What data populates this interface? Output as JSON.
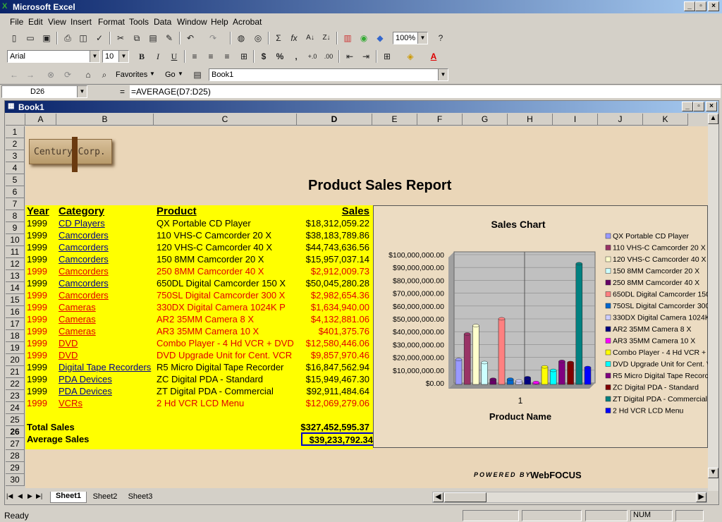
{
  "app": {
    "title": "Microsoft Excel"
  },
  "menu": [
    "File",
    "Edit",
    "View",
    "Insert",
    "Format",
    "Tools",
    "Data",
    "Window",
    "Help",
    "Acrobat"
  ],
  "toolbar": {
    "font": "Arial",
    "size": "10",
    "zoom": "100%",
    "favorites": "Favorites",
    "go": "Go",
    "address": "Book1"
  },
  "formula": {
    "cellref": "D26",
    "eq": "=",
    "content": "=AVERAGE(D7:D25)"
  },
  "workbook": {
    "title": "Book1"
  },
  "columns": [
    "A",
    "B",
    "C",
    "D",
    "E",
    "F",
    "G",
    "H",
    "I",
    "J",
    "K"
  ],
  "rows": [
    "1",
    "2",
    "3",
    "4",
    "5",
    "6",
    "7",
    "8",
    "9",
    "10",
    "11",
    "12",
    "13",
    "14",
    "15",
    "16",
    "17",
    "18",
    "19",
    "20",
    "21",
    "22",
    "23",
    "24",
    "25",
    "26",
    "27",
    "28",
    "29",
    "30"
  ],
  "logo": "Century Corp.",
  "report_title": "Product Sales Report",
  "headers": {
    "year": "Year",
    "category": "Category",
    "product": "Product",
    "sales": "Sales"
  },
  "data_rows": [
    {
      "year": "1999",
      "category": "CD Players",
      "product": "QX Portable CD Player",
      "sales": "$18,312,059.22",
      "red": false
    },
    {
      "year": "1999",
      "category": "Camcorders",
      "product": "110 VHS-C Camcorder 20 X",
      "sales": "$38,183,789.86",
      "red": false
    },
    {
      "year": "1999",
      "category": "Camcorders",
      "product": "120 VHS-C Camcorder 40 X",
      "sales": "$44,743,636.56",
      "red": false
    },
    {
      "year": "1999",
      "category": "Camcorders",
      "product": "150 8MM Camcorder 20 X",
      "sales": "$15,957,037.14",
      "red": false
    },
    {
      "year": "1999",
      "category": "Camcorders",
      "product": "250 8MM Camcorder 40 X",
      "sales": "$2,912,009.73",
      "red": true
    },
    {
      "year": "1999",
      "category": "Camcorders",
      "product": "650DL Digital Camcorder 150 X",
      "sales": "$50,045,280.28",
      "red": false
    },
    {
      "year": "1999",
      "category": "Camcorders",
      "product": "750SL Digital Camcorder 300 X",
      "sales": "$2,982,654.36",
      "red": true
    },
    {
      "year": "1999",
      "category": "Cameras",
      "product": "330DX Digital Camera 1024K P",
      "sales": "$1,634,940.00",
      "red": true
    },
    {
      "year": "1999",
      "category": "Cameras",
      "product": "AR2 35MM Camera 8 X",
      "sales": "$4,132,881.06",
      "red": true
    },
    {
      "year": "1999",
      "category": "Cameras",
      "product": "AR3 35MM Camera 10 X",
      "sales": "$401,375.76",
      "red": true
    },
    {
      "year": "1999",
      "category": "DVD",
      "product": "Combo Player - 4 Hd VCR + DVD",
      "sales": "$12,580,446.06",
      "red": true
    },
    {
      "year": "1999",
      "category": "DVD",
      "product": "DVD Upgrade Unit for Cent. VCR",
      "sales": "$9,857,970.46",
      "red": true
    },
    {
      "year": "1999",
      "category": "Digital Tape Recorders",
      "product": "R5 Micro Digital Tape Recorder",
      "sales": "$16,847,562.94",
      "red": false
    },
    {
      "year": "1999",
      "category": "PDA Devices",
      "product": "ZC Digital PDA - Standard",
      "sales": "$15,949,467.30",
      "red": false
    },
    {
      "year": "1999",
      "category": "PDA Devices",
      "product": "ZT Digital PDA - Commercial",
      "sales": "$92,911,484.64",
      "red": false
    },
    {
      "year": "1999",
      "category": "VCRs",
      "product": "2 Hd VCR LCD Menu",
      "sales": "$12,069,279.06",
      "red": true
    }
  ],
  "totals": {
    "total_label": "Total Sales",
    "total_value": "$327,452,595.37",
    "avg_label": "Average Sales",
    "avg_value": "$39,233,792.34"
  },
  "powered": {
    "line1": "POWERED BY",
    "line2": "WebFOCUS"
  },
  "sheets": [
    "Sheet1",
    "Sheet2",
    "Sheet3"
  ],
  "status": {
    "left": "Ready",
    "num": "NUM"
  },
  "chart_data": {
    "type": "bar",
    "title": "Sales Chart",
    "xlabel": "Product Name",
    "categories": [
      "1"
    ],
    "ylim": [
      0,
      100000000
    ],
    "yticks": [
      "$0.00",
      "$10,000,000.00",
      "$20,000,000.00",
      "$30,000,000.00",
      "$40,000,000.00",
      "$50,000,000.00",
      "$60,000,000.00",
      "$70,000,000.00",
      "$80,000,000.00",
      "$90,000,000.00",
      "$100,000,000.00"
    ],
    "series": [
      {
        "name": "QX Portable CD Player",
        "values": [
          18312059.22
        ],
        "color": "#9999ff"
      },
      {
        "name": "110 VHS-C Camcorder 20 X",
        "values": [
          38183789.86
        ],
        "color": "#993366"
      },
      {
        "name": "120 VHS-C Camcorder 40 X",
        "values": [
          44743636.56
        ],
        "color": "#ffffcc"
      },
      {
        "name": "150 8MM Camcorder 20 X",
        "values": [
          15957037.14
        ],
        "color": "#ccffff"
      },
      {
        "name": "250 8MM Camcorder 40 X",
        "values": [
          2912009.73
        ],
        "color": "#660066"
      },
      {
        "name": "650DL Digital Camcorder 150",
        "values": [
          50045280.28
        ],
        "color": "#ff8080"
      },
      {
        "name": "750SL Digital Camcorder 300",
        "values": [
          2982654.36
        ],
        "color": "#0066cc"
      },
      {
        "name": "330DX Digital Camera 1024K",
        "values": [
          1634940.0
        ],
        "color": "#ccccff"
      },
      {
        "name": "AR2 35MM Camera 8 X",
        "values": [
          4132881.06
        ],
        "color": "#000080"
      },
      {
        "name": "AR3 35MM Camera 10 X",
        "values": [
          401375.76
        ],
        "color": "#ff00ff"
      },
      {
        "name": "Combo Player - 4 Hd VCR + I",
        "values": [
          12580446.06
        ],
        "color": "#ffff00"
      },
      {
        "name": "DVD Upgrade Unit for Cent. V",
        "values": [
          9857970.46
        ],
        "color": "#00ffff"
      },
      {
        "name": "R5 Micro Digital Tape Recorc",
        "values": [
          16847562.94
        ],
        "color": "#800080"
      },
      {
        "name": "ZC Digital PDA - Standard",
        "values": [
          15949467.3
        ],
        "color": "#800000"
      },
      {
        "name": "ZT Digital PDA - Commercial",
        "values": [
          92911484.64
        ],
        "color": "#008080"
      },
      {
        "name": "2 Hd VCR LCD Menu",
        "values": [
          12069279.06
        ],
        "color": "#0000ff"
      }
    ]
  }
}
